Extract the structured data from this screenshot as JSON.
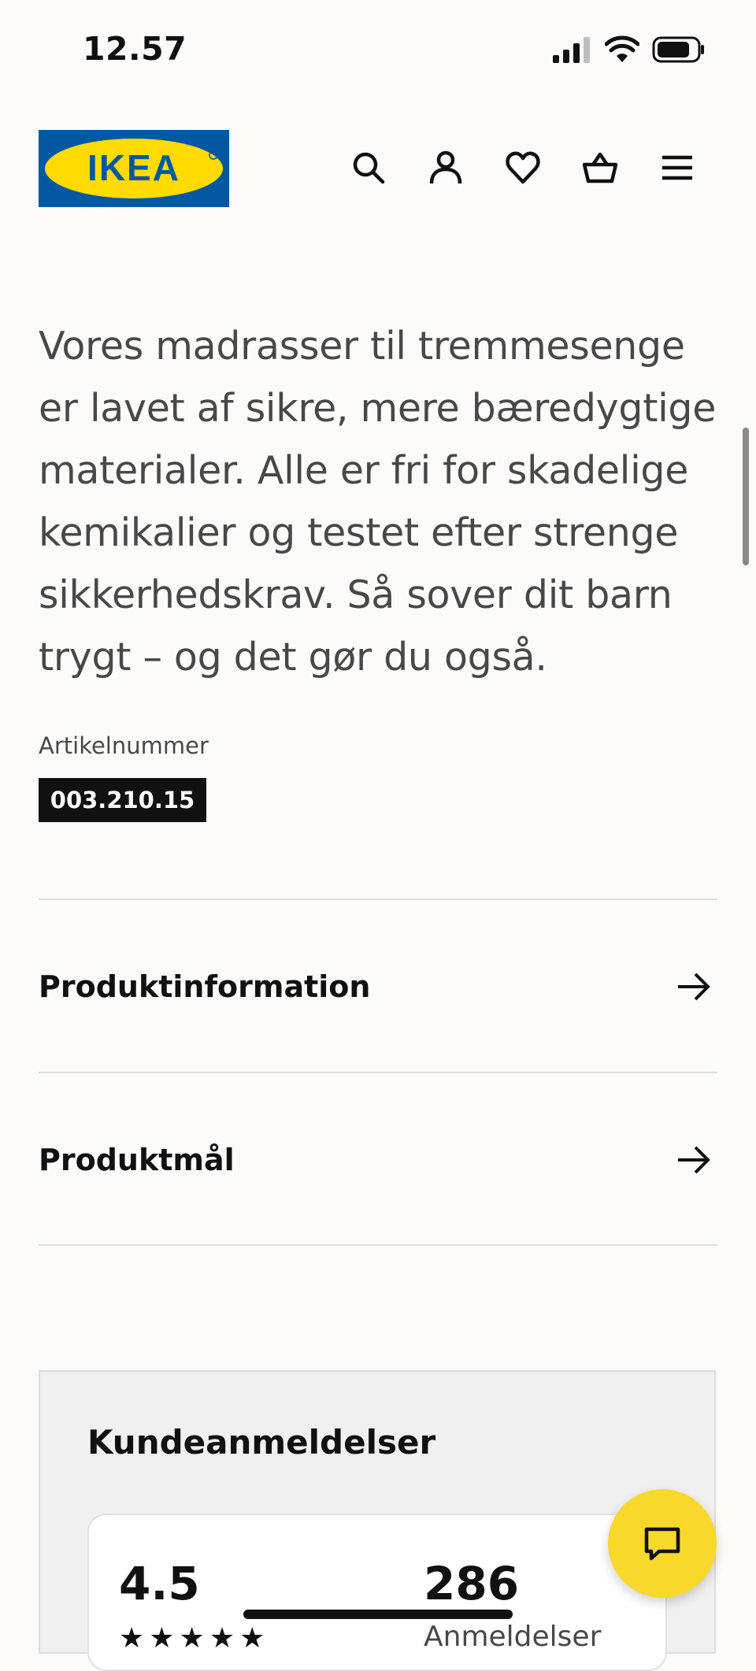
{
  "status_bar": {
    "time": "12.57",
    "icons": [
      "cellular-signal-icon",
      "wifi-icon",
      "battery-icon"
    ]
  },
  "header": {
    "logo_text": "IKEA",
    "icons": [
      "search-icon",
      "account-icon",
      "heart-icon",
      "basket-icon",
      "menu-icon"
    ]
  },
  "product": {
    "description": "Vores madrasser til tremmesenge er lavet af sikre, mere bæredygtige materialer. Alle er fri for skadelige kemikalier og testet efter strenge sikkerhedskrav. Så sover dit barn trygt – og det gør du også.",
    "article_label": "Artikelnummer",
    "article_number": "003.210.15"
  },
  "accordion": [
    {
      "label": "Produktinformation"
    },
    {
      "label": "Produktmål"
    }
  ],
  "reviews": {
    "title": "Kundeanmeldelser",
    "rating": "4.5",
    "count": "286",
    "count_label": "Anmeldelser",
    "stars": "★★★★★"
  },
  "colors": {
    "ikea_blue": "#0058a3",
    "ikea_yellow": "#ffdb00",
    "chat_yellow": "#f8d82a"
  }
}
